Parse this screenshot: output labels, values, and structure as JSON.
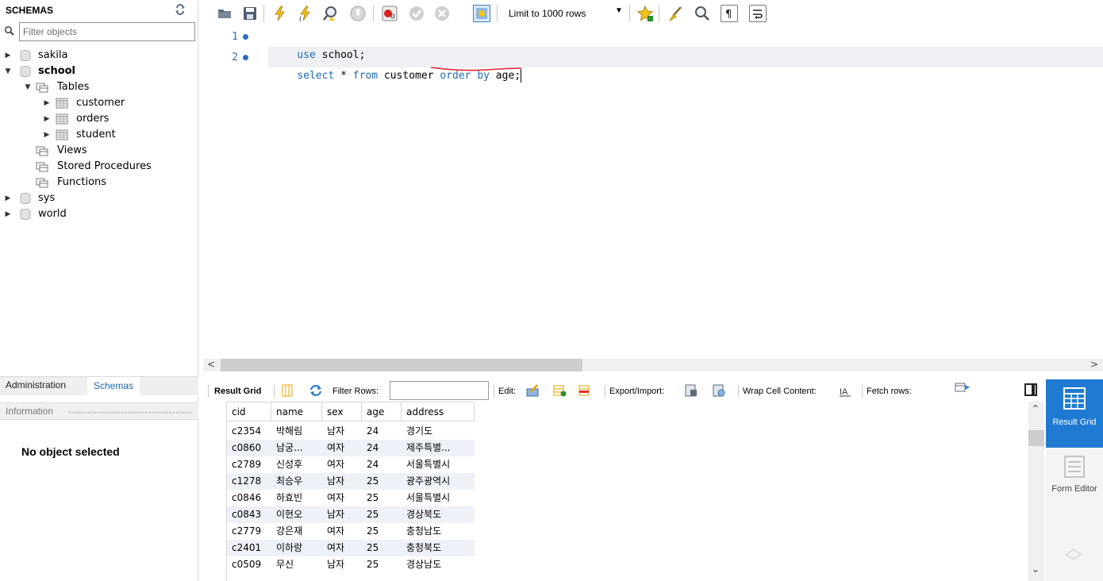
{
  "sidebar": {
    "title": "SCHEMAS",
    "filter_placeholder": "Filter objects",
    "tree": {
      "sakila": "sakila",
      "school": "school",
      "tables": "Tables",
      "customer": "customer",
      "orders": "orders",
      "student": "student",
      "views": "Views",
      "stored_procedures": "Stored Procedures",
      "functions": "Functions",
      "sys": "sys",
      "world": "world"
    },
    "tabs": {
      "administration": "Administration",
      "schemas": "Schemas"
    },
    "info_title": "Information",
    "no_object": "No object selected"
  },
  "toolbar": {
    "limit_label": "Limit to 1000 rows",
    "icons": [
      "open-file-icon",
      "save-icon",
      "execute-icon",
      "execute-current-icon",
      "explain-icon",
      "stop-icon",
      "toggle-error-icon",
      "commit-icon",
      "rollback-icon",
      "autocommit-icon",
      "bookmark-icon",
      "beautify-icon",
      "find-icon",
      "invisible-chars-icon",
      "wrap-lines-icon"
    ]
  },
  "editor": {
    "lines": [
      {
        "num": "1",
        "parts": [
          [
            "kw",
            "use"
          ],
          [
            "",
            " school;"
          ]
        ]
      },
      {
        "num": "2",
        "parts": [
          [
            "kw",
            "select"
          ],
          [
            "",
            " * "
          ],
          [
            "kw",
            "from"
          ],
          [
            "",
            " customer "
          ],
          [
            "kw",
            "order"
          ],
          [
            "",
            " "
          ],
          [
            "kw",
            "by"
          ],
          [
            "",
            " age;"
          ]
        ]
      }
    ],
    "colors": {
      "keyword": "#1f69b4",
      "line_number": "#3a6ea5",
      "annotation": "#e0202a"
    }
  },
  "result_toolbar": {
    "result_grid": "Result Grid",
    "filter_rows": "Filter Rows:",
    "edit": "Edit:",
    "export_import": "Export/Import:",
    "wrap_cell": "Wrap Cell Content:",
    "fetch_rows": "Fetch rows:"
  },
  "grid": {
    "columns": [
      "cid",
      "name",
      "sex",
      "age",
      "address"
    ],
    "rows": [
      [
        "c2354",
        "박해림",
        "남자",
        "24",
        "경기도"
      ],
      [
        "c0860",
        "남궁...",
        "여자",
        "24",
        "제주특별..."
      ],
      [
        "c2789",
        "신성후",
        "여자",
        "24",
        "서울특별시"
      ],
      [
        "c1278",
        "최승우",
        "남자",
        "25",
        "광주광역시"
      ],
      [
        "c0846",
        "하효빈",
        "여자",
        "25",
        "서울특별시"
      ],
      [
        "c0843",
        "이현오",
        "남자",
        "25",
        "경상북도"
      ],
      [
        "c2779",
        "강은재",
        "여자",
        "25",
        "충청남도"
      ],
      [
        "c2401",
        "이하랑",
        "여자",
        "25",
        "충청북도"
      ],
      [
        "c0509",
        "무신",
        "남자",
        "25",
        "경상남도"
      ]
    ]
  },
  "right_panel": {
    "result_grid": "Result Grid",
    "form_editor": "Form Editor"
  }
}
